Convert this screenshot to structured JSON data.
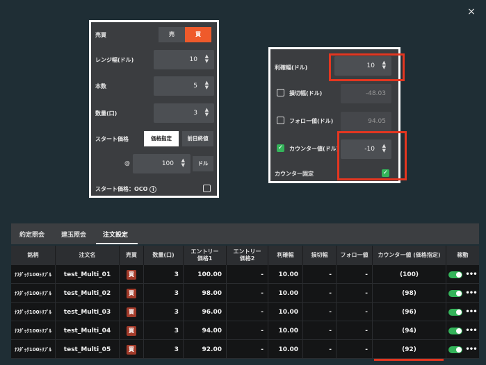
{
  "close_glyph": "×",
  "left_panel": {
    "side_label": "売買",
    "sell_label": "売",
    "buy_label": "買",
    "range_label": "レンジ幅(ドル)",
    "range_value": "10",
    "count_label": "本数",
    "count_value": "5",
    "qty_label": "数量(口)",
    "qty_value": "3",
    "start_label": "スタート価格",
    "start_opt1": "価格指定",
    "start_opt2": "前日終値",
    "at_mark": "@",
    "start_value": "100",
    "unit": "ドル",
    "oco_label": "スタート価格：OCO",
    "info_glyph": "i"
  },
  "right_panel": {
    "tp_label": "利確幅(ドル)",
    "tp_value": "10",
    "sl_label": "損切幅(ドル)",
    "sl_value": "-48.03",
    "follow_label": "フォロー値(ドル)",
    "follow_value": "94.05",
    "counter_label": "カウンター値(ドル)",
    "counter_value": "-10",
    "counter_fixed_label": "カウンター固定",
    "check_glyph": "✓"
  },
  "tabs": [
    "約定照会",
    "建玉照会",
    "注文設定"
  ],
  "table": {
    "headers": [
      "銘柄",
      "注文名",
      "売買",
      "数量(口)",
      "エントリー\n価格1",
      "エントリー\n価格2",
      "利確幅",
      "損切幅",
      "フォロー値",
      "カウンター値 (価格指定)",
      "稼動"
    ],
    "rows": [
      {
        "symbol": "ﾅｽﾀﾞｯｸ100ﾄﾘﾌﾟﾙ",
        "name": "test_Multi_01",
        "side": "買",
        "qty": "3",
        "entry1": "100.00",
        "entry2": "-",
        "tp": "10.00",
        "sl": "-",
        "follow": "-",
        "counter": "(100)",
        "more": "•••"
      },
      {
        "symbol": "ﾅｽﾀﾞｯｸ100ﾄﾘﾌﾟﾙ",
        "name": "test_Multi_02",
        "side": "買",
        "qty": "3",
        "entry1": "98.00",
        "entry2": "-",
        "tp": "10.00",
        "sl": "-",
        "follow": "-",
        "counter": "(98)",
        "more": "•••"
      },
      {
        "symbol": "ﾅｽﾀﾞｯｸ100ﾄﾘﾌﾟﾙ",
        "name": "test_Multi_03",
        "side": "買",
        "qty": "3",
        "entry1": "96.00",
        "entry2": "-",
        "tp": "10.00",
        "sl": "-",
        "follow": "-",
        "counter": "(96)",
        "more": "•••"
      },
      {
        "symbol": "ﾅｽﾀﾞｯｸ100ﾄﾘﾌﾟﾙ",
        "name": "test_Multi_04",
        "side": "買",
        "qty": "3",
        "entry1": "94.00",
        "entry2": "-",
        "tp": "10.00",
        "sl": "-",
        "follow": "-",
        "counter": "(94)",
        "more": "•••"
      },
      {
        "symbol": "ﾅｽﾀﾞｯｸ100ﾄﾘﾌﾟﾙ",
        "name": "test_Multi_05",
        "side": "買",
        "qty": "3",
        "entry1": "92.00",
        "entry2": "-",
        "tp": "10.00",
        "sl": "-",
        "follow": "-",
        "counter": "(92)",
        "more": "•••"
      }
    ]
  },
  "colors": {
    "accent": "#ef5a2b",
    "highlight": "#e43620",
    "toggle_on": "#34b45a",
    "buy_badge": "#a33b2a"
  }
}
